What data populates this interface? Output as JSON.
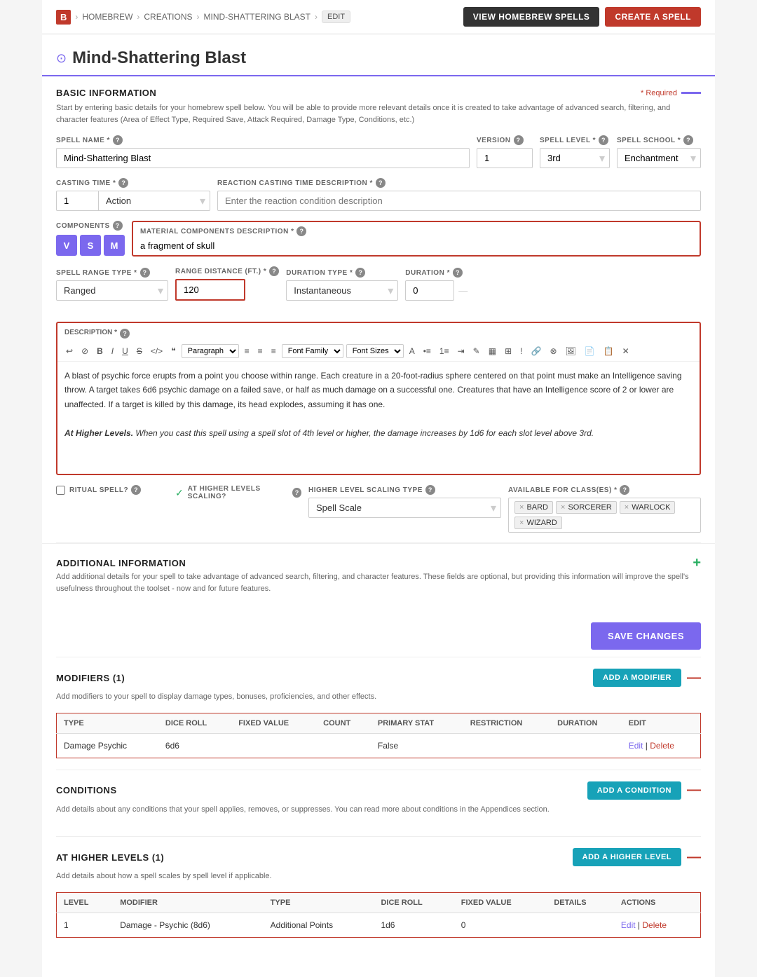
{
  "nav": {
    "logo": "B",
    "breadcrumbs": [
      "HOMEBREW",
      "CREATIONS",
      "MIND-SHATTERING BLAST",
      "EDIT"
    ],
    "view_spells_btn": "VIEW HOMEBREW SPELLS",
    "create_spell_btn": "CREATE A SPELL"
  },
  "page": {
    "title": "Mind-Shattering Blast",
    "title_icon": "⊙"
  },
  "basic_info": {
    "title": "BASIC INFORMATION",
    "required_label": "* Required",
    "description": "Start by entering basic details for your homebrew spell below. You will be able to provide more relevant details once it is created to take advantage of advanced search, filtering, and character features (Area of Effect Type, Required Save, Attack Required, Damage Type, Conditions, etc.)"
  },
  "fields": {
    "spell_name_label": "SPELL NAME *",
    "spell_name_value": "Mind-Shattering Blast",
    "version_label": "VERSION",
    "version_value": "1",
    "spell_level_label": "SPELL LEVEL *",
    "spell_level_value": "3rd",
    "spell_school_label": "SPELL SCHOOL *",
    "spell_school_value": "Enchantment",
    "casting_time_label": "CASTING TIME *",
    "casting_time_num": "1",
    "casting_time_type": "Action",
    "reaction_label": "REACTION CASTING TIME DESCRIPTION *",
    "reaction_placeholder": "Enter the reaction condition description",
    "components_label": "COMPONENTS",
    "comp_v": "V",
    "comp_s": "S",
    "comp_m": "M",
    "material_label": "MATERIAL COMPONENTS DESCRIPTION *",
    "material_value": "a fragment of skull",
    "range_type_label": "SPELL RANGE TYPE *",
    "range_type_value": "Ranged",
    "range_dist_label": "RANGE DISTANCE (FT.) *",
    "range_dist_value": "120",
    "duration_type_label": "DURATION TYPE *",
    "duration_type_value": "Instantaneous",
    "duration_label": "DURATION *",
    "duration_value": "0",
    "description_label": "DESCRIPTION *",
    "description_text": "A blast of psychic force erupts from a point you choose within range. Each creature in a 20-foot-radius sphere centered on that point must make an Intelligence saving throw. A target takes 6d6 psychic damage on a failed save, or half as much damage on a successful one. Creatures that have an Intelligence score of 2 or lower are unaffected. If a target is killed by this damage, its head explodes, assuming it has one.",
    "description_higher": "At Higher Levels. When you cast this spell using a spell slot of 4th level or higher, the damage increases by 1d6 for each slot level above 3rd.",
    "ritual_label": "RITUAL SPELL?",
    "higher_scaling_label": "AT HIGHER LEVELS SCALING?",
    "higher_scaling_icon": "✓",
    "scaling_type_label": "HIGHER LEVEL SCALING TYPE",
    "scaling_type_value": "Spell Scale",
    "classes_label": "AVAILABLE FOR CLASS(ES) *",
    "classes": [
      "BARD",
      "SORCERER",
      "WARLOCK",
      "WIZARD"
    ]
  },
  "additional": {
    "title": "ADDITIONAL INFORMATION",
    "description": "Add additional details for your spell to take advantage of advanced search, filtering, and character features. These fields are optional, but providing this information will improve the spell's usefulness throughout the toolset - now and for future features."
  },
  "save_btn": "SAVE CHANGES",
  "modifiers": {
    "title": "MODIFIERS (1)",
    "description": "Add modifiers to your spell to display damage types, bonuses, proficiencies, and other effects.",
    "add_btn": "ADD A MODIFIER",
    "columns": [
      "TYPE",
      "DICE ROLL",
      "FIXED VALUE",
      "COUNT",
      "PRIMARY STAT",
      "RESTRICTION",
      "DURATION",
      "EDIT"
    ],
    "rows": [
      {
        "type": "Damage Psychic",
        "dice_roll": "6d6",
        "fixed_value": "",
        "count": "",
        "primary_stat": "False",
        "restriction": "",
        "duration": "",
        "edit": "Edit | Delete"
      }
    ]
  },
  "conditions": {
    "title": "CONDITIONS",
    "description": "Add details about any conditions that your spell applies, removes, or suppresses. You can read more about conditions in the Appendices section.",
    "add_btn": "ADD A CONDITION"
  },
  "higher_levels": {
    "title": "AT HIGHER LEVELS (1)",
    "description": "Add details about how a spell scales by spell level if applicable.",
    "add_btn": "ADD A HIGHER LEVEL",
    "columns": [
      "LEVEL",
      "MODIFIER",
      "TYPE",
      "DICE ROLL",
      "FIXED VALUE",
      "DETAILS",
      "ACTIONS"
    ],
    "rows": [
      {
        "level": "1",
        "modifier": "Damage - Psychic (8d6)",
        "type": "Additional Points",
        "dice_roll": "1d6",
        "fixed_value": "0",
        "details": "",
        "actions": "Edit | Delete"
      }
    ]
  },
  "toolbar": {
    "buttons": [
      "↩",
      "⊘",
      "B",
      "I",
      "U",
      "S",
      "</>",
      "❝",
      "¶",
      "Font Family",
      "Font Sizes",
      "A",
      "•≡",
      "1≡",
      "≡",
      "✎",
      "▤",
      "▦",
      "!",
      "🔗",
      "⊗",
      "🖼",
      "📄",
      "📋",
      "⊗"
    ]
  }
}
